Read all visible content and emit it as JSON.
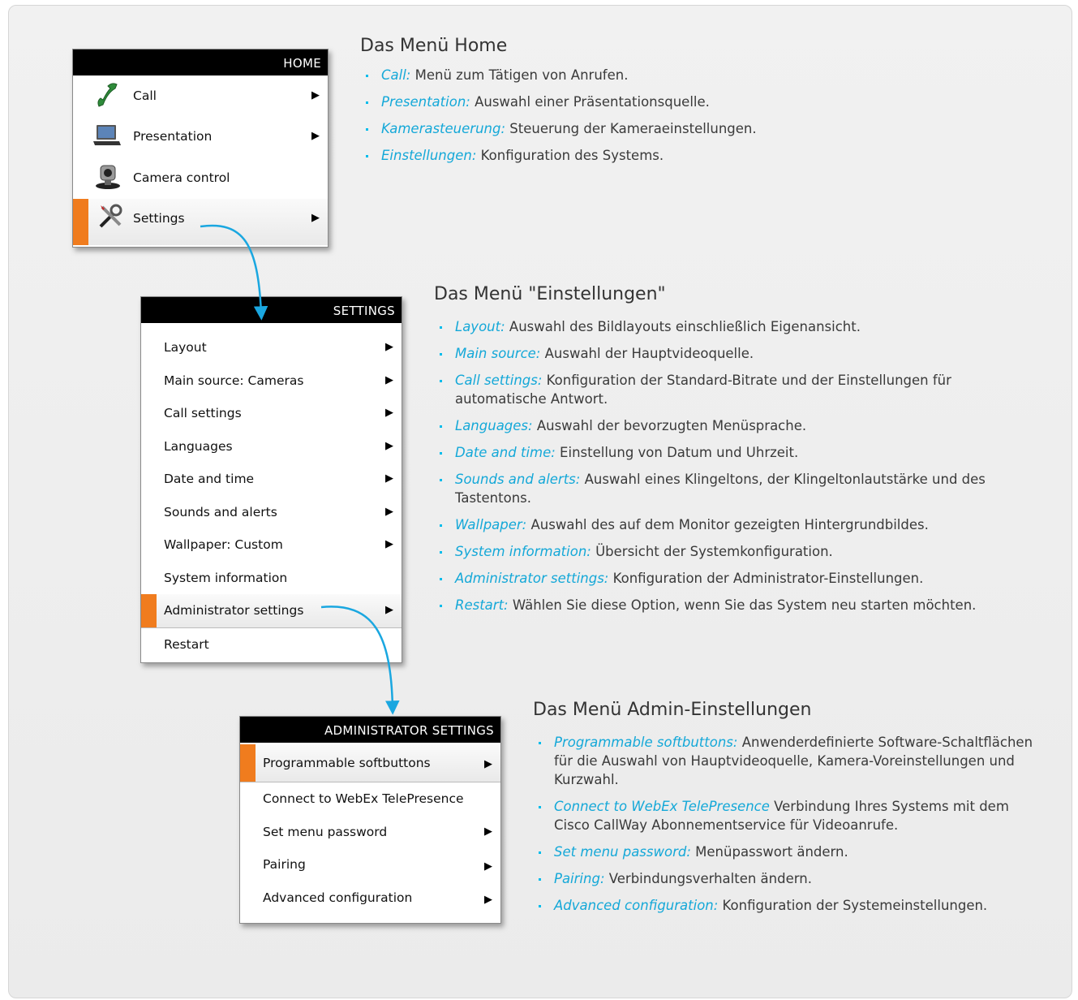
{
  "home_menu": {
    "header": "HOME",
    "items": [
      {
        "label": "Call",
        "icon": "phone-handset-icon",
        "arrow": true
      },
      {
        "label": "Presentation",
        "icon": "laptop-icon",
        "arrow": true
      },
      {
        "label": "Camera control",
        "icon": "camera-icon",
        "arrow": false
      },
      {
        "label": "Settings",
        "icon": "tools-icon",
        "arrow": true,
        "selected": true
      }
    ]
  },
  "settings_menu": {
    "header": "SETTINGS",
    "items": [
      {
        "label": "Layout",
        "arrow": true
      },
      {
        "label": "Main source: Cameras",
        "arrow": true
      },
      {
        "label": "Call settings",
        "arrow": true
      },
      {
        "label": "Languages",
        "arrow": true
      },
      {
        "label": "Date and time",
        "arrow": true
      },
      {
        "label": "Sounds and alerts",
        "arrow": true
      },
      {
        "label": "Wallpaper: Custom",
        "arrow": true
      },
      {
        "label": "System information",
        "arrow": false
      },
      {
        "label": "Administrator settings",
        "arrow": true,
        "selected": true
      },
      {
        "label": "Restart",
        "arrow": false
      }
    ]
  },
  "admin_menu": {
    "header": "ADMINISTRATOR SETTINGS",
    "items": [
      {
        "label": "Programmable softbuttons",
        "arrow": true,
        "selected": true
      },
      {
        "label": "Connect to WebEx TelePresence",
        "arrow": false
      },
      {
        "label": "Set menu password",
        "arrow": true
      },
      {
        "label": "Pairing",
        "arrow": true
      },
      {
        "label": "Advanced configuration",
        "arrow": true
      }
    ]
  },
  "home_desc": {
    "title": "Das Menü Home",
    "items": [
      {
        "term": "Call:",
        "text": " Menü zum Tätigen von Anrufen."
      },
      {
        "term": "Presentation:",
        "text": " Auswahl einer Präsentationsquelle."
      },
      {
        "term": "Kamerasteuerung:",
        "text": " Steuerung der Kameraeinstellungen."
      },
      {
        "term": "Einstellungen:",
        "text": " Konfiguration des Systems."
      }
    ]
  },
  "settings_desc": {
    "title": "Das Menü \"Einstellungen\"",
    "items": [
      {
        "term": "Layout:",
        "text": " Auswahl des Bildlayouts einschließlich Eigenansicht."
      },
      {
        "term": "Main source:",
        "text": " Auswahl der Hauptvideoquelle."
      },
      {
        "term": "Call settings:",
        "text": " Konfiguration der Standard-Bitrate und der Einstellungen für automatische Antwort."
      },
      {
        "term": "Languages:",
        "text": " Auswahl der bevorzugten Menüsprache."
      },
      {
        "term": "Date and time:",
        "text": " Einstellung von Datum und Uhrzeit."
      },
      {
        "term": "Sounds and alerts:",
        "text": " Auswahl eines Klingeltons, der Klingeltonlautstärke und des Tastentons."
      },
      {
        "term": "Wallpaper:",
        "text": " Auswahl des auf dem Monitor gezeigten Hintergrundbildes."
      },
      {
        "term": "System information:",
        "text": " Übersicht der Systemkonfiguration."
      },
      {
        "term": "Administrator settings:",
        "text": " Konfiguration der  Administrator-Einstellungen."
      },
      {
        "term": "Restart:",
        "text": " Wählen Sie diese Option, wenn Sie das System neu starten möchten."
      }
    ]
  },
  "admin_desc": {
    "title": "Das Menü Admin-Einstellungen",
    "items": [
      {
        "term": "Programmable softbuttons:",
        "text": " Anwenderdefinierte Software-Schaltflächen für die Auswahl von Hauptvideoquelle, Kamera-Voreinstellungen und Kurzwahl."
      },
      {
        "term": "Connect to WebEx TelePresence",
        "text": " Verbindung Ihres Systems mit dem Cisco CallWay Abonnementservice für Videoanrufe."
      },
      {
        "term": "Set menu password:",
        "text": " Menüpasswort ändern."
      },
      {
        "term": "Pairing:",
        "text": " Verbindungsverhalten ändern."
      },
      {
        "term": "Advanced configuration:",
        "text": " Konfiguration der Systemeinstellungen."
      }
    ]
  },
  "colors": {
    "accent_orange": "#f07c1e",
    "term_blue": "#14a8d8",
    "arrow_blue": "#1aa7e0"
  }
}
